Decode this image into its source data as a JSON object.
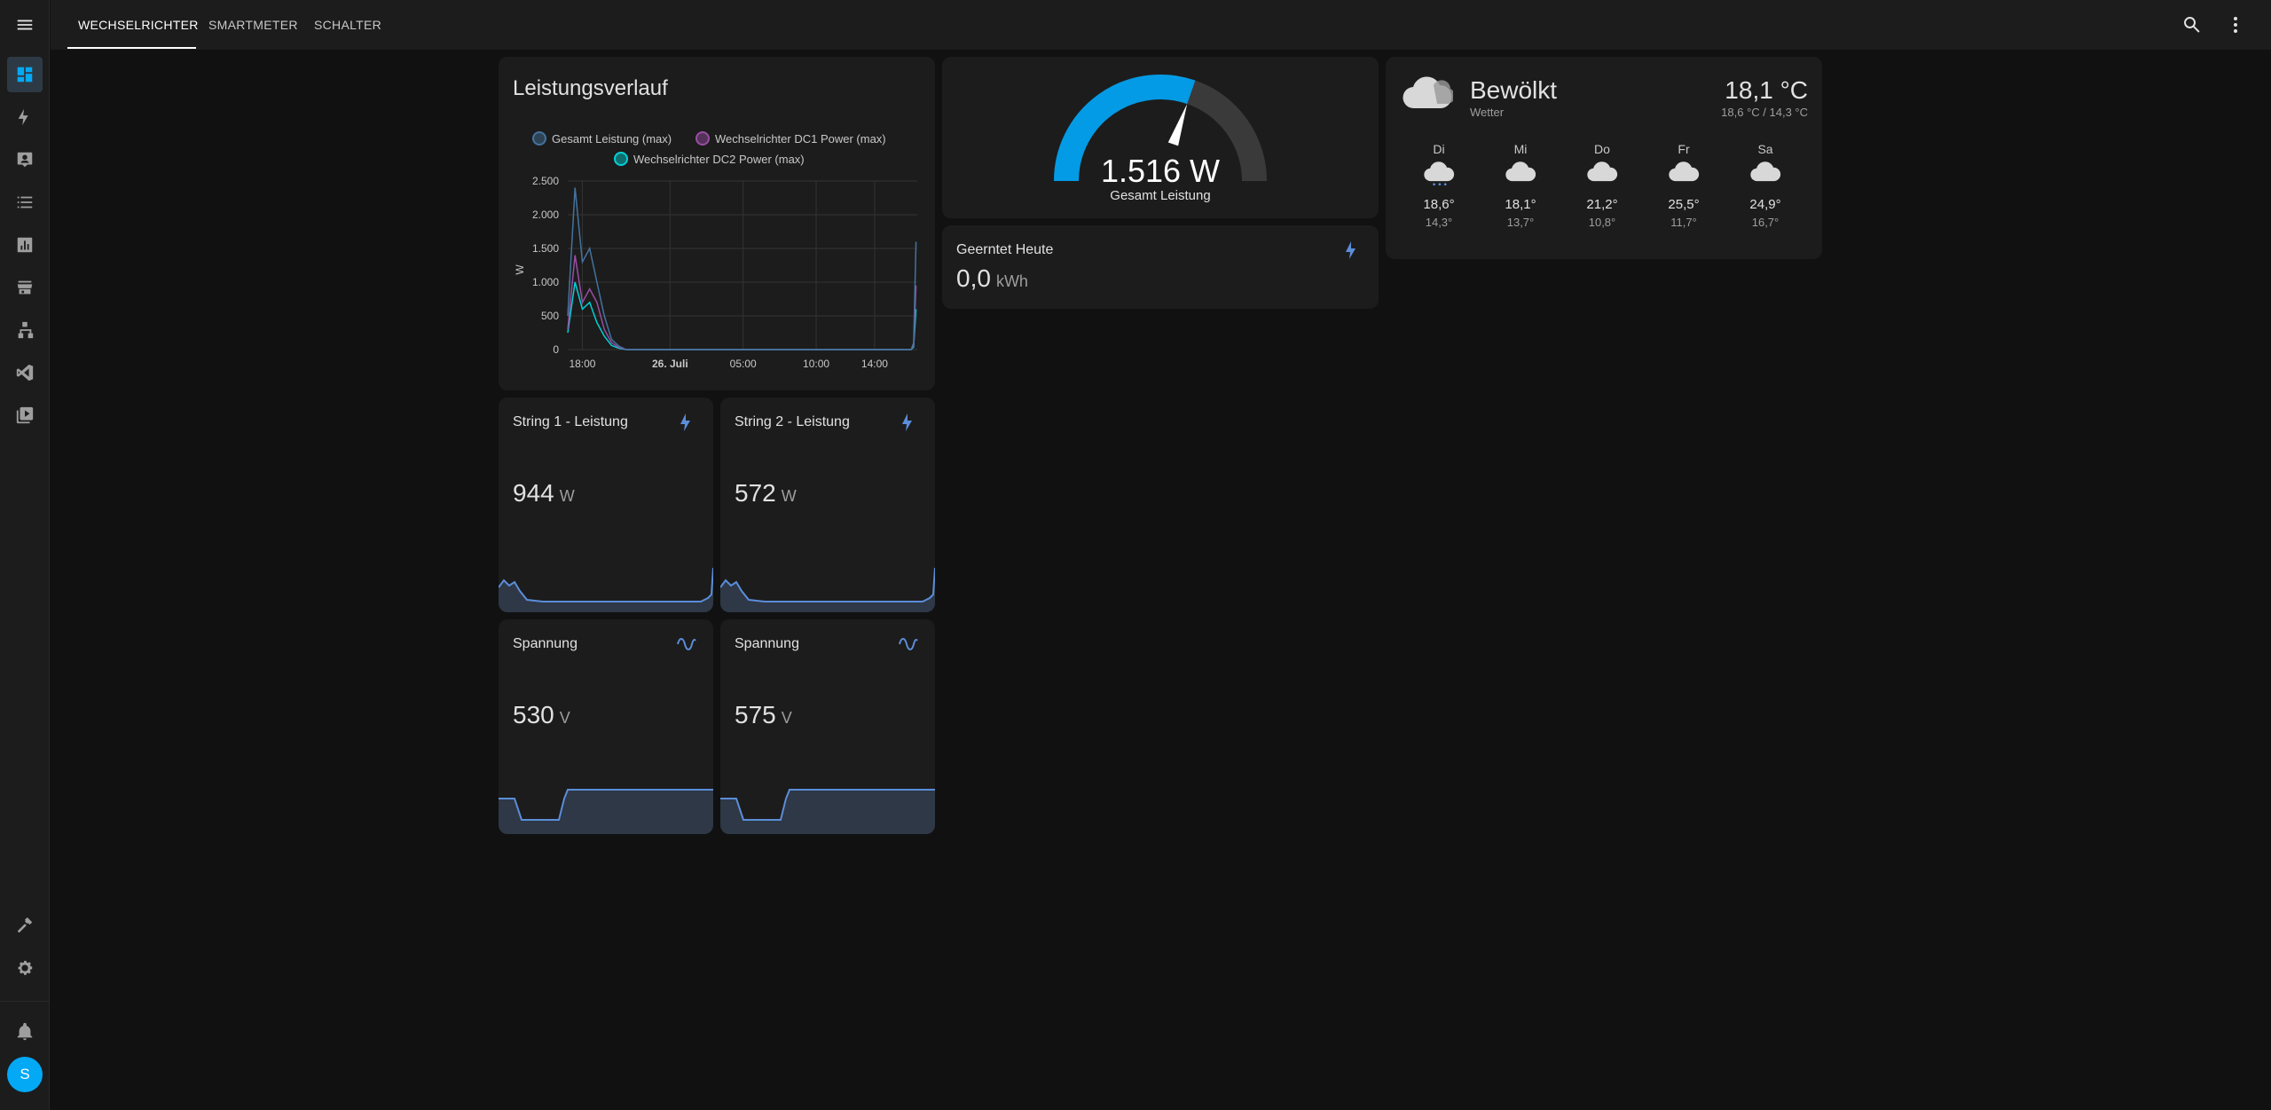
{
  "header": {
    "tabs": [
      {
        "label": "WECHSELRICHTER"
      },
      {
        "label": "SMARTMETER"
      },
      {
        "label": "SCHALTER"
      }
    ]
  },
  "sidebar": {
    "user_initial": "S"
  },
  "history": {
    "title": "Leistungsverlauf",
    "legend": [
      {
        "name": "Gesamt Leistung (max)",
        "color": "#44739e"
      },
      {
        "name": "Wechselrichter DC1 Power (max)",
        "color": "#984ea3"
      },
      {
        "name": "Wechselrichter DC2 Power (max)",
        "color": "#00d2d5"
      }
    ],
    "ylabel": "W",
    "yticks": [
      "2.500",
      "2.000",
      "1.500",
      "1.000",
      "500",
      "0"
    ],
    "xticks": [
      "18:00",
      "26. Juli",
      "05:00",
      "10:00",
      "14:00"
    ]
  },
  "chart_data": {
    "type": "line",
    "title": "Leistungsverlauf",
    "ylabel": "W",
    "ylim": [
      0,
      2500
    ],
    "x_ticks": [
      "18:00",
      "26. Juli",
      "05:00",
      "10:00",
      "14:00"
    ],
    "x": [
      "17:00",
      "17:30",
      "18:00",
      "18:30",
      "19:00",
      "19:30",
      "20:00",
      "20:30",
      "21:00",
      "22:00",
      "05:00",
      "10:00",
      "14:00",
      "16:30",
      "16:40",
      "16:50"
    ],
    "series": [
      {
        "name": "Gesamt Leistung (max)",
        "values": [
          500,
          2400,
          1300,
          1500,
          1000,
          500,
          150,
          50,
          0,
          0,
          0,
          0,
          0,
          0,
          100,
          1600
        ]
      },
      {
        "name": "Wechselrichter DC1 Power (max)",
        "values": [
          300,
          1400,
          700,
          900,
          700,
          300,
          100,
          30,
          0,
          0,
          0,
          0,
          0,
          0,
          60,
          950
        ]
      },
      {
        "name": "Wechselrichter DC2 Power (max)",
        "values": [
          250,
          1000,
          600,
          700,
          400,
          200,
          60,
          20,
          0,
          0,
          0,
          0,
          0,
          0,
          40,
          600
        ]
      }
    ],
    "grid": true,
    "legend": "top"
  },
  "gauge": {
    "value": 1516,
    "max": 2500,
    "value_text": "1.516 W",
    "label": "Gesamt Leistung",
    "color": "#039be5"
  },
  "energy_today": {
    "title": "Geerntet Heute",
    "value": "0,0",
    "unit": "kWh",
    "icon": "flash-icon"
  },
  "weather": {
    "condition": "Bewölkt",
    "name": "Wetter",
    "temperature": "18,1 °C",
    "range": "18,6 °C / 14,3 °C",
    "forecast": [
      {
        "day": "Di",
        "high": "18,6°",
        "low": "14,3°",
        "icon": "cloud-rain-icon"
      },
      {
        "day": "Mi",
        "high": "18,1°",
        "low": "13,7°",
        "icon": "cloud-icon"
      },
      {
        "day": "Do",
        "high": "21,2°",
        "low": "10,8°",
        "icon": "cloud-icon"
      },
      {
        "day": "Fr",
        "high": "25,5°",
        "low": "11,7°",
        "icon": "cloud-icon"
      },
      {
        "day": "Sa",
        "high": "24,9°",
        "low": "16,7°",
        "icon": "cloud-icon"
      }
    ]
  },
  "sensors": [
    {
      "title": "String 1 - Leistung",
      "value": "944",
      "unit": "W",
      "icon": "flash-icon"
    },
    {
      "title": "String 2 - Leistung",
      "value": "572",
      "unit": "W",
      "icon": "flash-icon"
    },
    {
      "title": "Spannung",
      "value": "530",
      "unit": "V",
      "icon": "sine-wave-icon"
    },
    {
      "title": "Spannung",
      "value": "575",
      "unit": "V",
      "icon": "sine-wave-icon"
    }
  ],
  "colors": {
    "accent": "#03a9f4",
    "spark_line": "#5b8dd9",
    "spark_fill": "#2e3846"
  }
}
